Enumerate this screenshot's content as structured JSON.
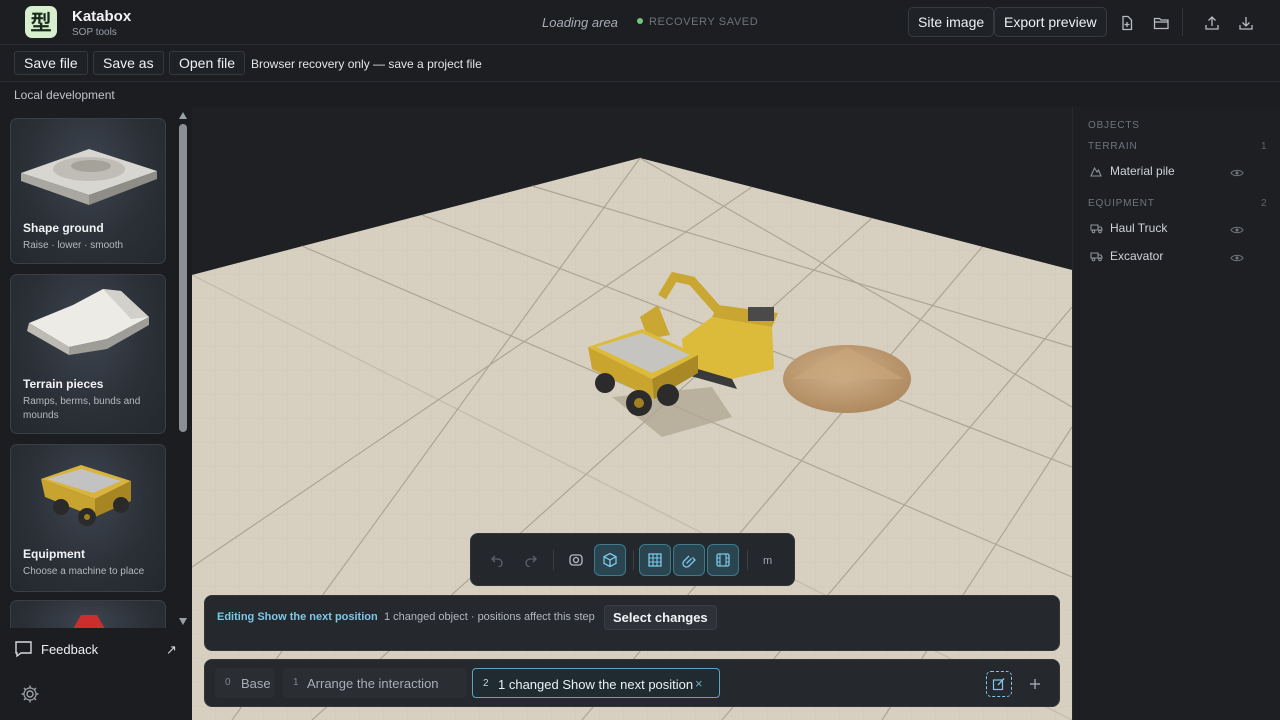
{
  "app": {
    "logo_glyph": "型",
    "name": "Katabox",
    "subtitle": "SOP tools"
  },
  "status": {
    "area": "Loading area",
    "saved": "RECOVERY SAVED",
    "saved_color": "#6fc77a"
  },
  "header": {
    "site_image_label": "Site image",
    "export_preview_label": "Export preview",
    "icons": [
      "new-file-icon",
      "open-folder-icon",
      "upload-icon",
      "download-icon"
    ]
  },
  "toolbar": {
    "save_file_label": "Save file",
    "save_as_label": "Save as",
    "open_file_label": "Open file",
    "note": "Browser recovery only — save a project file"
  },
  "environment": "Local development",
  "library": {
    "cards": [
      {
        "title": "Shape ground",
        "desc": "Raise · lower · smooth"
      },
      {
        "title": "Terrain pieces",
        "desc": "Ramps, berms, bunds and mounds"
      },
      {
        "title": "Equipment",
        "desc": "Choose a machine to place"
      }
    ]
  },
  "sidebar_footer": {
    "feedback_label": "Feedback",
    "external_glyph": "↗"
  },
  "objects_panel": {
    "heading": "OBJECTS",
    "groups": [
      {
        "name": "TERRAIN",
        "count": "1",
        "items": [
          {
            "label": "Material pile",
            "icon": "terrain-icon"
          }
        ]
      },
      {
        "name": "EQUIPMENT",
        "count": "2",
        "items": [
          {
            "label": "Haul Truck",
            "icon": "truck-icon"
          },
          {
            "label": "Excavator",
            "icon": "truck-icon"
          }
        ]
      }
    ]
  },
  "viewport_toolbar": {
    "unit": "m",
    "buttons": [
      "undo-icon",
      "redo-icon",
      "camera-view-icon",
      "perspective-cube-icon",
      "grid-icon",
      "snap-magnet-icon",
      "film-icon"
    ],
    "active": [
      "perspective-cube-icon",
      "grid-icon",
      "snap-magnet-icon",
      "film-icon"
    ],
    "accent": "#7cc8e8"
  },
  "edit_bar": {
    "title": "Editing Show the next position",
    "meta": "1 changed object · positions affect this step",
    "select_changes_label": "Select changes"
  },
  "steps": [
    {
      "num": "0",
      "label": "Base"
    },
    {
      "num": "1",
      "label": "Arrange the interaction"
    },
    {
      "num": "2",
      "label": "1 changed  Show the next position",
      "active": true
    }
  ]
}
